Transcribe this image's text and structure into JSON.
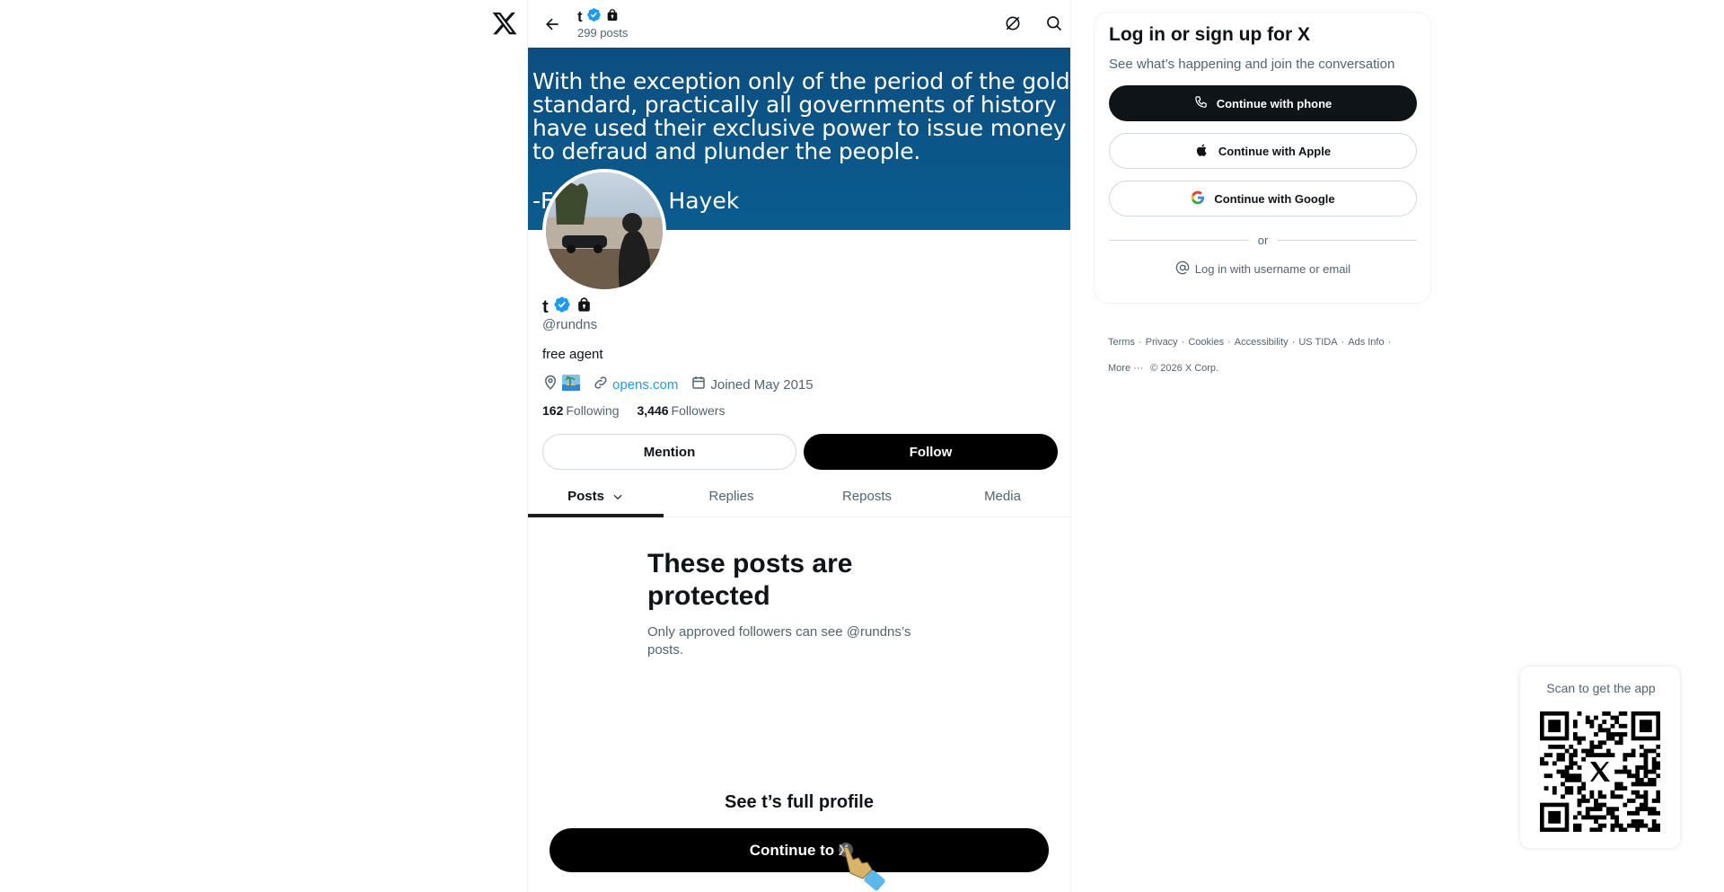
{
  "header": {
    "name": "t",
    "post_count": "299 posts"
  },
  "banner": {
    "quote": "With the exception only of the period of the gold standard, practically all governments of history have used their exclusive power to issue money to defraud and plunder the people.",
    "author_prefix": "-F",
    "author_suffix": "Hayek"
  },
  "profile": {
    "name": "t",
    "handle": "@rundns",
    "bio": "free agent",
    "website": "opens.com",
    "joined": "Joined May 2015",
    "following_count": "162",
    "following_label": "Following",
    "followers_count": "3,446",
    "followers_label": "Followers",
    "mention_label": "Mention",
    "follow_label": "Follow"
  },
  "tabs": [
    {
      "label": "Posts"
    },
    {
      "label": "Replies"
    },
    {
      "label": "Reposts"
    },
    {
      "label": "Media"
    }
  ],
  "protected": {
    "title": "These posts are protected",
    "description": "Only approved followers can see @rundns’s posts."
  },
  "cta": {
    "see_full": "See t’s full profile",
    "continue_label": "Continue to X"
  },
  "login": {
    "title": "Log in or sign up for X",
    "subtitle": "See what’s happening and join the conversation",
    "phone": "Continue with phone",
    "apple": "Continue with Apple",
    "google": "Continue with Google",
    "or": "or",
    "username": "Log in with username or email"
  },
  "footer": {
    "terms": "Terms",
    "privacy": "Privacy",
    "cookies": "Cookies",
    "accessibility": "Accessibility",
    "us_tida": "US TIDA",
    "ads_info": "Ads Info",
    "more": "More",
    "copyright": "© 2026 X Corp."
  },
  "qr": {
    "label": "Scan to get the app"
  },
  "colors": {
    "accent": "#1d9bf0",
    "banner": "#0a5c8f",
    "text": "#0f1419",
    "muted": "#536471"
  }
}
